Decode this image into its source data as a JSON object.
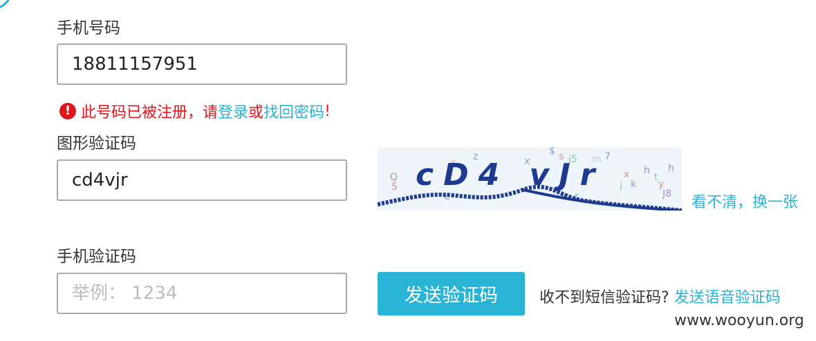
{
  "phone": {
    "label": "手机号码",
    "value": "18811157951"
  },
  "error": {
    "icon": "warning-icon",
    "text_before": "此号码已被注册，请",
    "login_link": "登录",
    "or": "或",
    "recover_link": "找回密码",
    "text_after": "!"
  },
  "captcha": {
    "label": "图形验证码",
    "value": "cd4vjr",
    "image_text": "cD4 vJr",
    "refresh_link": "看不清，换一张"
  },
  "sms": {
    "label": "手机验证码",
    "placeholder": "举例： 1234",
    "send_button": "发送验证码",
    "no_sms_text": "收不到短信验证码?",
    "voice_link": "发送语音验证码"
  },
  "watermark": "www.wooyun.org",
  "colors": {
    "accent": "#2ab1d3",
    "error": "#e0161d",
    "button": "#29b4d6"
  }
}
